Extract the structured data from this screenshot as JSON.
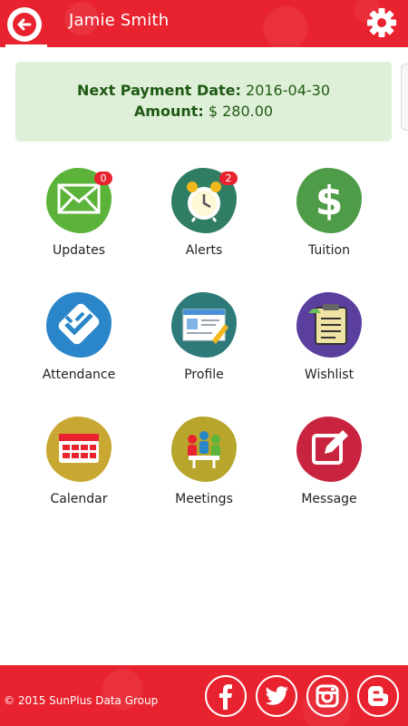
{
  "header": {
    "title": "Jamie Smith",
    "back_icon": "arrow-left-icon",
    "settings_icon": "gear-icon"
  },
  "payment": {
    "date_label": "Next Payment Date:",
    "date_value": "2016-04-30",
    "amount_label": "Amount:",
    "amount_value": "$ 280.00"
  },
  "tiles": [
    {
      "label": "Updates",
      "icon": "envelope-icon",
      "badge": "0",
      "color": "#5bb33a"
    },
    {
      "label": "Alerts",
      "icon": "alarm-clock-icon",
      "badge": "2",
      "color": "#2f7d63"
    },
    {
      "label": "Tuition",
      "icon": "dollar-icon",
      "color": "#4e9c47"
    },
    {
      "label": "Attendance",
      "icon": "double-check-icon",
      "color": "#2a86c9"
    },
    {
      "label": "Profile",
      "icon": "profile-card-icon",
      "color": "#2e7a7a"
    },
    {
      "label": "Wishlist",
      "icon": "clipboard-icon",
      "color": "#5a3f9e"
    },
    {
      "label": "Calendar",
      "icon": "calendar-icon",
      "color": "#c8a832"
    },
    {
      "label": "Meetings",
      "icon": "meeting-icon",
      "color": "#b7a52c"
    },
    {
      "label": "Message",
      "icon": "compose-icon",
      "color": "#c9243f"
    }
  ],
  "footer": {
    "copyright": "© 2015 SunPlus Data Group",
    "social": [
      "facebook-icon",
      "twitter-icon",
      "instagram-icon",
      "blogger-icon"
    ]
  },
  "colors": {
    "brand_red": "#e8232f",
    "card_bg": "#dff0d8",
    "card_text": "#1f5a14"
  }
}
